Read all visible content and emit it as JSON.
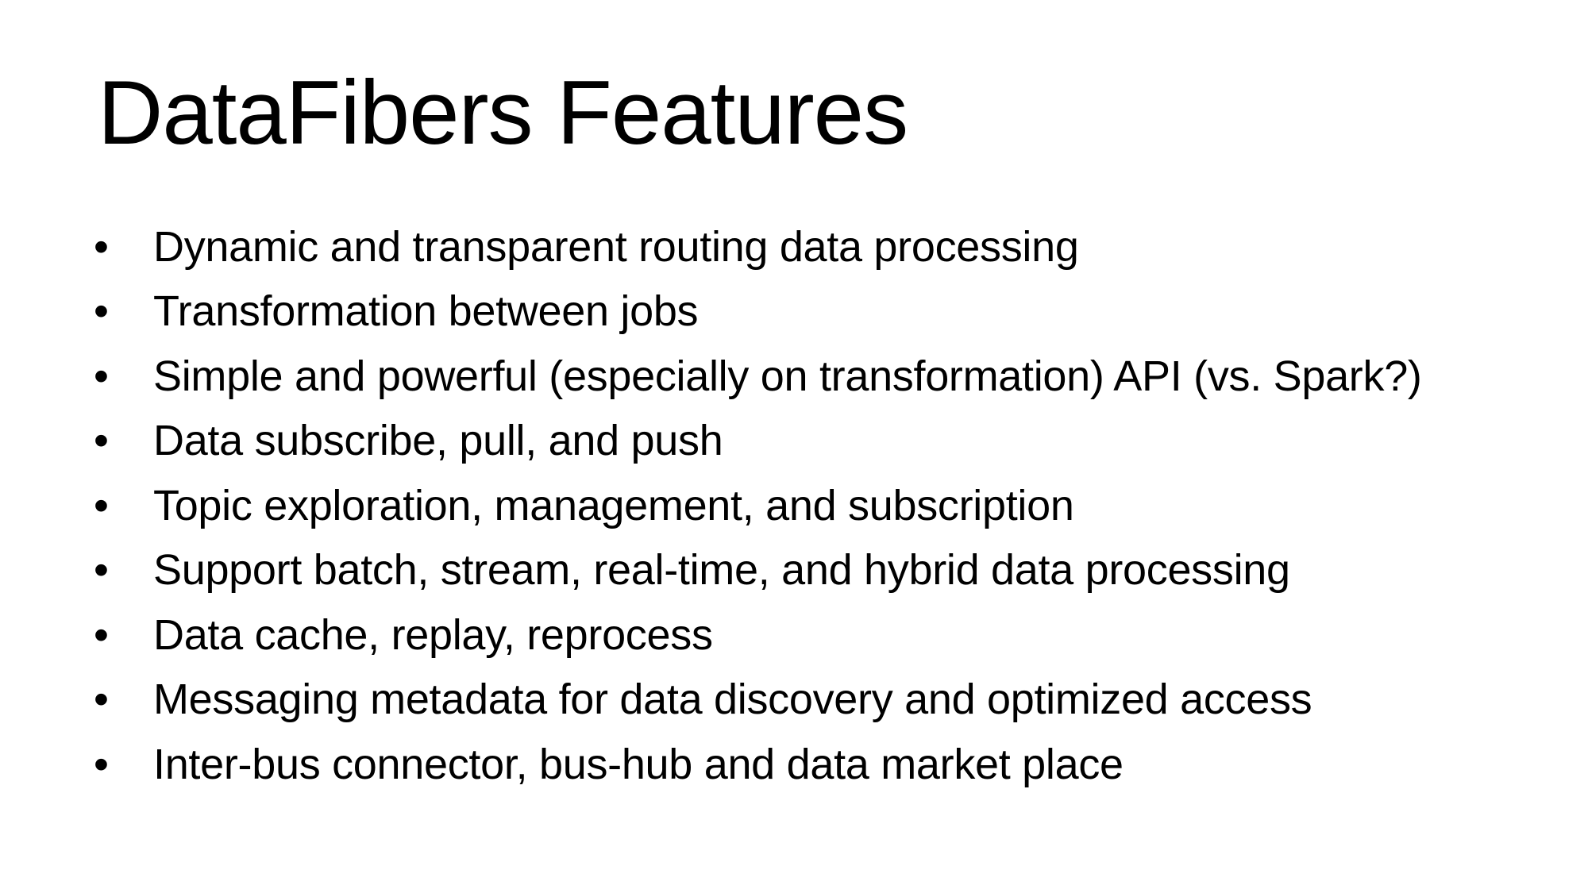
{
  "slide": {
    "title": "DataFibers Features",
    "bullet_symbol": "•",
    "bullets": [
      "Dynamic and transparent routing data processing",
      "Transformation between jobs",
      "Simple and powerful (especially on transformation) API (vs. Spark?)",
      "Data subscribe, pull, and push",
      "Topic exploration, management, and subscription",
      "Support batch, stream, real-time, and hybrid data processing",
      "Data cache, replay, reprocess",
      "Messaging metadata for data discovery and optimized access",
      "Inter-bus connector, bus-hub and data market place"
    ]
  },
  "colors": {
    "background": "#ffffff",
    "text": "#000000"
  }
}
